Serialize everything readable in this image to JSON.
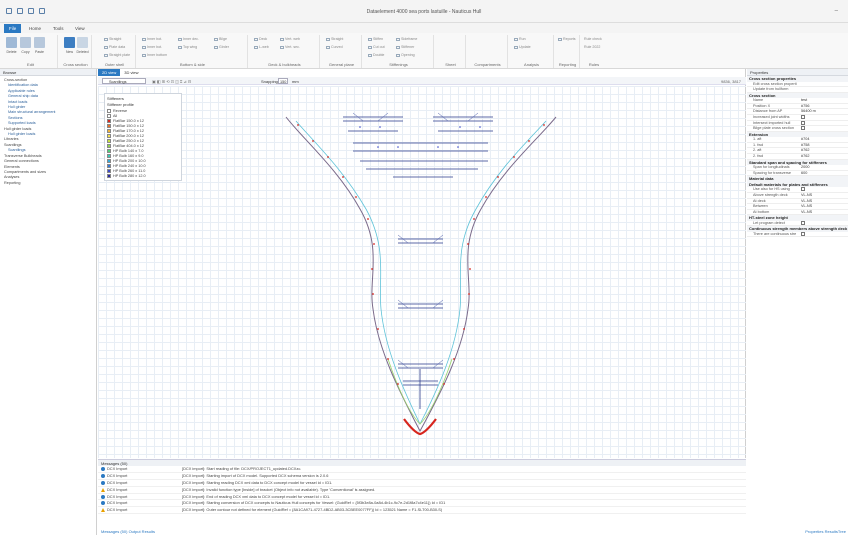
{
  "titlebar": {
    "title": "Dataelement 4000 sea ports lastuille - Nauticus Hull"
  },
  "tabs": [
    "File",
    "Home",
    "Tools",
    "View"
  ],
  "ribbon": {
    "groups": [
      {
        "label": "Edit"
      },
      {
        "label": "Cross section"
      },
      {
        "label": "Outer shell"
      },
      {
        "label": "Bottom & side"
      },
      {
        "label": "Deck & bulkheads"
      },
      {
        "label": "General plane"
      },
      {
        "label": "Stiffenings"
      },
      {
        "label": "Sheet"
      },
      {
        "label": "Compartments"
      },
      {
        "label": "Analysis"
      },
      {
        "label": "Reporting"
      },
      {
        "label": "Rules"
      }
    ],
    "bigbuttons": [
      "Delete",
      "Copy",
      "Paste",
      "New",
      "Deleted"
    ],
    "items": [
      "Straight",
      "Plate data",
      "Straight plate",
      "Inner bot.",
      "Inner bot.",
      "Inner bottom",
      "Inner dec.",
      "Top wing",
      "Bilge",
      "Girder",
      "Deck",
      "L-web",
      "Vert. web",
      "Vert. sec.",
      "Straight",
      "Curved",
      "Stiffen",
      "Cut out",
      "Double",
      "Sideframe",
      "Stiffener",
      "Opening",
      "Run",
      "Update",
      "Reports",
      "Rule check",
      "Rule 2022"
    ]
  },
  "browse": {
    "header": "Browse",
    "tree": [
      {
        "t": "Cross-section",
        "c": "l1"
      },
      {
        "t": "Identification data",
        "c": "l2"
      },
      {
        "t": "Applicable rules",
        "c": "l2"
      },
      {
        "t": "General ship data",
        "c": "l2"
      },
      {
        "t": "Intact loads",
        "c": "l2"
      },
      {
        "t": "Hull girder",
        "c": "l2"
      },
      {
        "t": "Main structural arrangement",
        "c": "l2"
      },
      {
        "t": "Sections",
        "c": "l2"
      },
      {
        "t": "Supported loads",
        "c": "l2"
      },
      {
        "t": "Hull girder loads",
        "c": "l1"
      },
      {
        "t": "Hull girder loads",
        "c": "l2"
      },
      {
        "t": "Libraries",
        "c": "l1"
      },
      {
        "t": "Scantlings",
        "c": "l1"
      },
      {
        "t": "Scantlings",
        "c": "l2"
      },
      {
        "t": "Transverse Bulkheads",
        "c": "l1"
      },
      {
        "t": "General connections",
        "c": "l1"
      },
      {
        "t": "Elements",
        "c": "l1"
      },
      {
        "t": "Compartments and sizes",
        "c": "l1"
      },
      {
        "t": "Analyses",
        "c": "l1"
      },
      {
        "t": "Reporting",
        "c": "l1"
      }
    ]
  },
  "canvas": {
    "tabs": [
      "2D view",
      "3D view"
    ],
    "view_select": "Scantlings",
    "snapping_label": "Snapping",
    "snap_value": "150",
    "snap_unit": "mm",
    "coords": "9836, 3817"
  },
  "legend": {
    "title": "Stiffeners",
    "subtitle": "Stiffener profile",
    "items": [
      {
        "label": "Reverse",
        "color": "#ffffff"
      },
      {
        "label": "All",
        "color": "#ffffff"
      },
      {
        "label": "FlatBar 150.0 x 12",
        "color": "#d7261e"
      },
      {
        "label": "FlatBar 150.0 x 12",
        "color": "#e8712a"
      },
      {
        "label": "FlatBar 170.0 x 12",
        "color": "#f2b33a"
      },
      {
        "label": "FlatBar 200.0 x 12",
        "color": "#f4e04a"
      },
      {
        "label": "FlatBar 250.0 x 12",
        "color": "#c8e03e"
      },
      {
        "label": "FlatBar 404.0 x 12",
        "color": "#8fd24a"
      },
      {
        "label": "HP Bulb 140 x 7.0",
        "color": "#4fcf7a"
      },
      {
        "label": "HP Bulb 160 x 9.0",
        "color": "#36c7b6"
      },
      {
        "label": "HP Bulb 200 x 10.0",
        "color": "#33a9d8"
      },
      {
        "label": "HP Bulb 240 x 10.0",
        "color": "#3379d8"
      },
      {
        "label": "HP Bulb 260 x 11.0",
        "color": "#3a48c8"
      },
      {
        "label": "HP Bulb 280 x 12.0",
        "color": "#2a2aa0"
      }
    ]
  },
  "properties": {
    "header": "Properties",
    "sections": [
      {
        "title": "Cross section properties",
        "rows": [
          {
            "k": "Edit cross section properti",
            "v": ""
          },
          {
            "k": "Update from hullform",
            "v": ""
          }
        ]
      },
      {
        "title": "Cross section",
        "rows": [
          {
            "k": "Name",
            "v": "test"
          },
          {
            "k": "Position X",
            "v": "#756"
          },
          {
            "k": "Distance from AP",
            "v": "56400 m"
          },
          {
            "k": "Increased joint widths",
            "v": "cb"
          },
          {
            "k": "Intersect imported hull",
            "v": "cb"
          },
          {
            "k": "Bilge plate cross section",
            "v": "cb"
          }
        ]
      },
      {
        "title": "Extension",
        "rows": [
          {
            "k": "1. aft",
            "v": "#704"
          },
          {
            "k": "1. fwd",
            "v": "#758"
          },
          {
            "k": "2. aft",
            "v": "#762"
          },
          {
            "k": "2. fwd",
            "v": "#762"
          }
        ]
      },
      {
        "title": "Standard span and spacing for stiffeners",
        "rows": [
          {
            "k": "Span for longitudinals",
            "v": "2000"
          },
          {
            "k": "Spacing for transverse",
            "v": "600"
          }
        ]
      },
      {
        "title": "Material data",
        "rows": []
      },
      {
        "title": "Default materials for plates and stiffeners",
        "rows": [
          {
            "k": "Use also for HS using",
            "v": "cb"
          },
          {
            "k": "Above strength deck",
            "v": "VL-NS"
          },
          {
            "k": "At deck",
            "v": "VL-NS"
          },
          {
            "k": "Between",
            "v": "VL-NS"
          },
          {
            "k": "At bottom",
            "v": "VL-NS"
          }
        ]
      },
      {
        "title": "HT-steel zone height",
        "rows": [
          {
            "k": "Let program detect",
            "v": "cb"
          }
        ]
      },
      {
        "title": "Continuous strength members above strength deck",
        "rows": [
          {
            "k": "There are continuous stre",
            "v": "cb"
          }
        ]
      }
    ],
    "bottom_tabs": "Properties   ResultsTree"
  },
  "messages": {
    "header": "Messages (50)",
    "rows": [
      {
        "icon": "info",
        "src": "DCX Import",
        "txt": "[DCX import]: Start reading of file: DCX/PROJECT1_updated.DCXzc."
      },
      {
        "icon": "info",
        "src": "DCX Import",
        "txt": "[DCX import]: Starting import of DCX model. Supported DCX schema version is 2.0.6"
      },
      {
        "icon": "info",
        "src": "DCX Import",
        "txt": "[DCX import]: Starting reading DCX xml data to DCX concept model for vessel id = ID1."
      },
      {
        "icon": "warn",
        "src": "DCX Import",
        "txt": "[DCX import]: Invalid function type [Inside] of bracket (Object info not available). Type 'Conventional' is assigned."
      },
      {
        "icon": "info",
        "src": "DCX Import",
        "txt": "[DCX import]: End of reading DCX xml data to DCX concept model for vessel id = ID1."
      },
      {
        "icon": "info",
        "src": "DCX Import",
        "txt": "[DCX import]: Starting conversion of DCX concepts to Nauticus Hull concepts for Vessel: (GuidRef = {5f3b3e8a-0a8d-4b1c-9c7e-2d1f8a7c4e11}) Id = ID1"
      },
      {
        "icon": "warn",
        "src": "DCX Import",
        "txt": "[DCX import]: Outer contour not defined for element (GuidRef = {8A1CA971-4727-4BD2-AB03-3CBEE0077FF}) Id = 123521 Name = F1-SLT00-B30-S)"
      }
    ],
    "tabs": "Messages (50)   Output   Results"
  }
}
